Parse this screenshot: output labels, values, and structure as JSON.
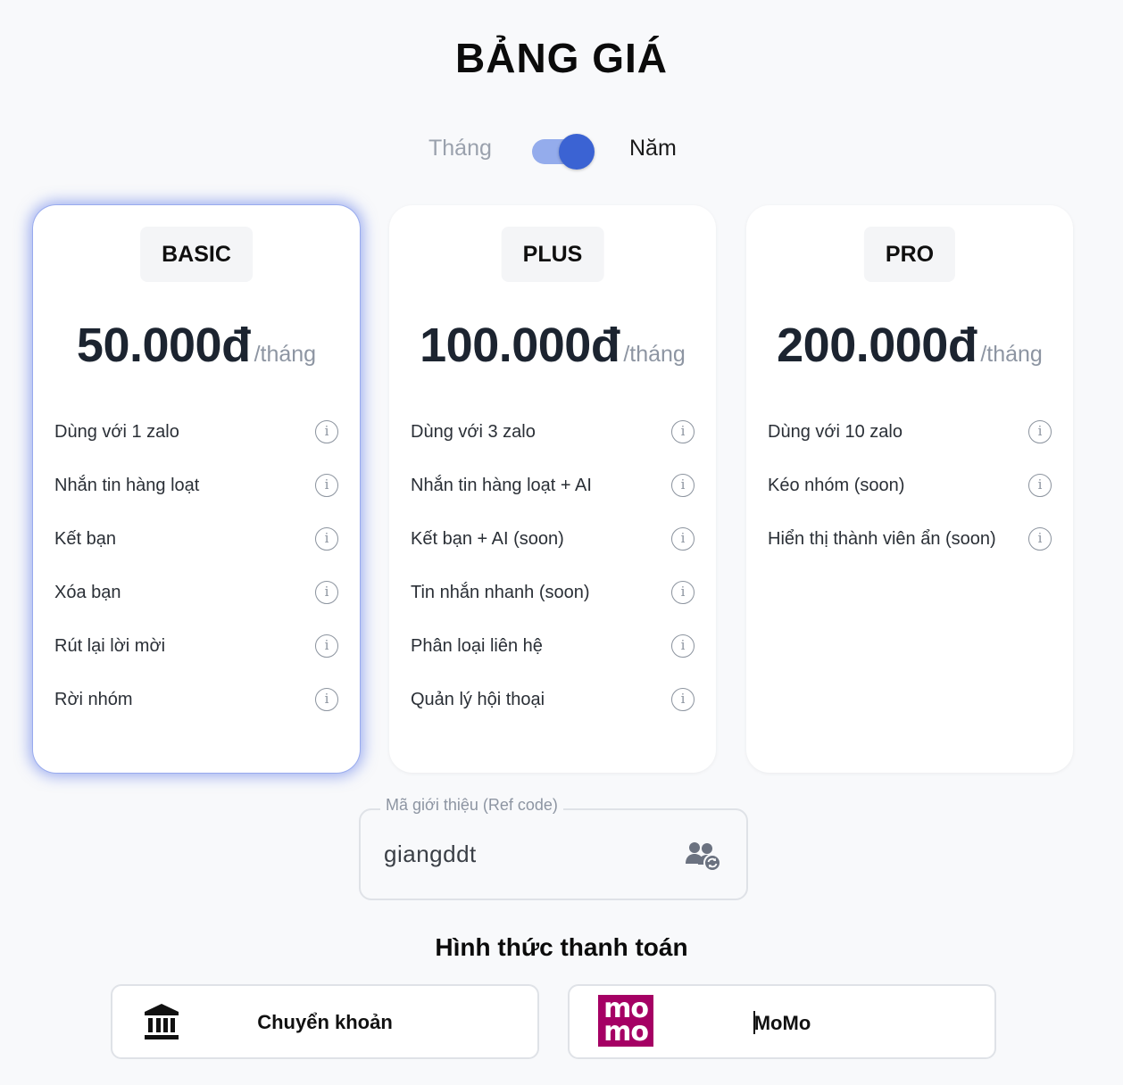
{
  "header": {
    "title": "BẢNG GIÁ"
  },
  "billing": {
    "monthly_label": "Tháng",
    "yearly_label": "Năm",
    "selected": "yearly"
  },
  "plans": [
    {
      "name": "BASIC",
      "price": "50.000đ",
      "unit": "/tháng",
      "selected": true,
      "features": [
        "Dùng với 1 zalo",
        "Nhắn tin hàng loạt",
        "Kết bạn",
        "Xóa bạn",
        "Rút lại lời mời",
        "Rời nhóm"
      ]
    },
    {
      "name": "PLUS",
      "price": "100.000đ",
      "unit": "/tháng",
      "selected": false,
      "features": [
        "Dùng với 3 zalo",
        "Nhắn tin hàng loạt + AI",
        "Kết bạn + AI (soon)",
        "Tin nhắn nhanh (soon)",
        "Phân loại liên hệ",
        "Quản lý hội thoại"
      ]
    },
    {
      "name": "PRO",
      "price": "200.000đ",
      "unit": "/tháng",
      "selected": false,
      "features": [
        "Dùng với 10 zalo",
        "Kéo nhóm (soon)",
        "Hiển thị thành viên ẩn (soon)"
      ]
    }
  ],
  "referral": {
    "label": "Mã giới thiệu (Ref code)",
    "value": "giangddt",
    "icon": "user-group-refresh-icon"
  },
  "payment": {
    "title": "Hình thức thanh toán",
    "methods": [
      {
        "label": "Chuyển khoản",
        "icon": "bank-icon"
      },
      {
        "label": "MoMo",
        "logo_text": "momo",
        "icon": "momo-logo",
        "logo_color": "#a50064"
      }
    ]
  },
  "colors": {
    "accent": "#3b63d3",
    "toggle_track": "#94acec",
    "momo": "#a50064"
  }
}
